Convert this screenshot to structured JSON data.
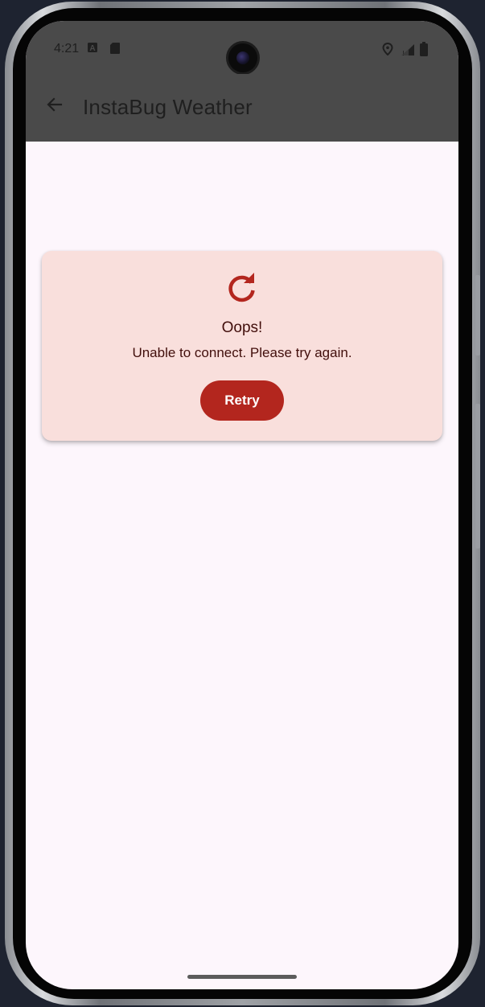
{
  "status_bar": {
    "time": "4:21",
    "left_icons": [
      "keyboard-a-icon",
      "sd-card-icon"
    ],
    "right_icons": [
      "location-icon",
      "signal-icon",
      "battery-icon"
    ]
  },
  "app_bar": {
    "back_icon": "arrow-left-icon",
    "title": "InstaBug Weather"
  },
  "error_card": {
    "icon": "refresh-icon",
    "title": "Oops!",
    "message": "Unable to connect. Please try again.",
    "retry_label": "Retry"
  },
  "colors": {
    "app_bar_bg": "#4a4a4a",
    "screen_bg": "#fdf6fc",
    "card_bg": "#f9dfdc",
    "accent": "#b3261e",
    "card_text": "#410e0b"
  }
}
